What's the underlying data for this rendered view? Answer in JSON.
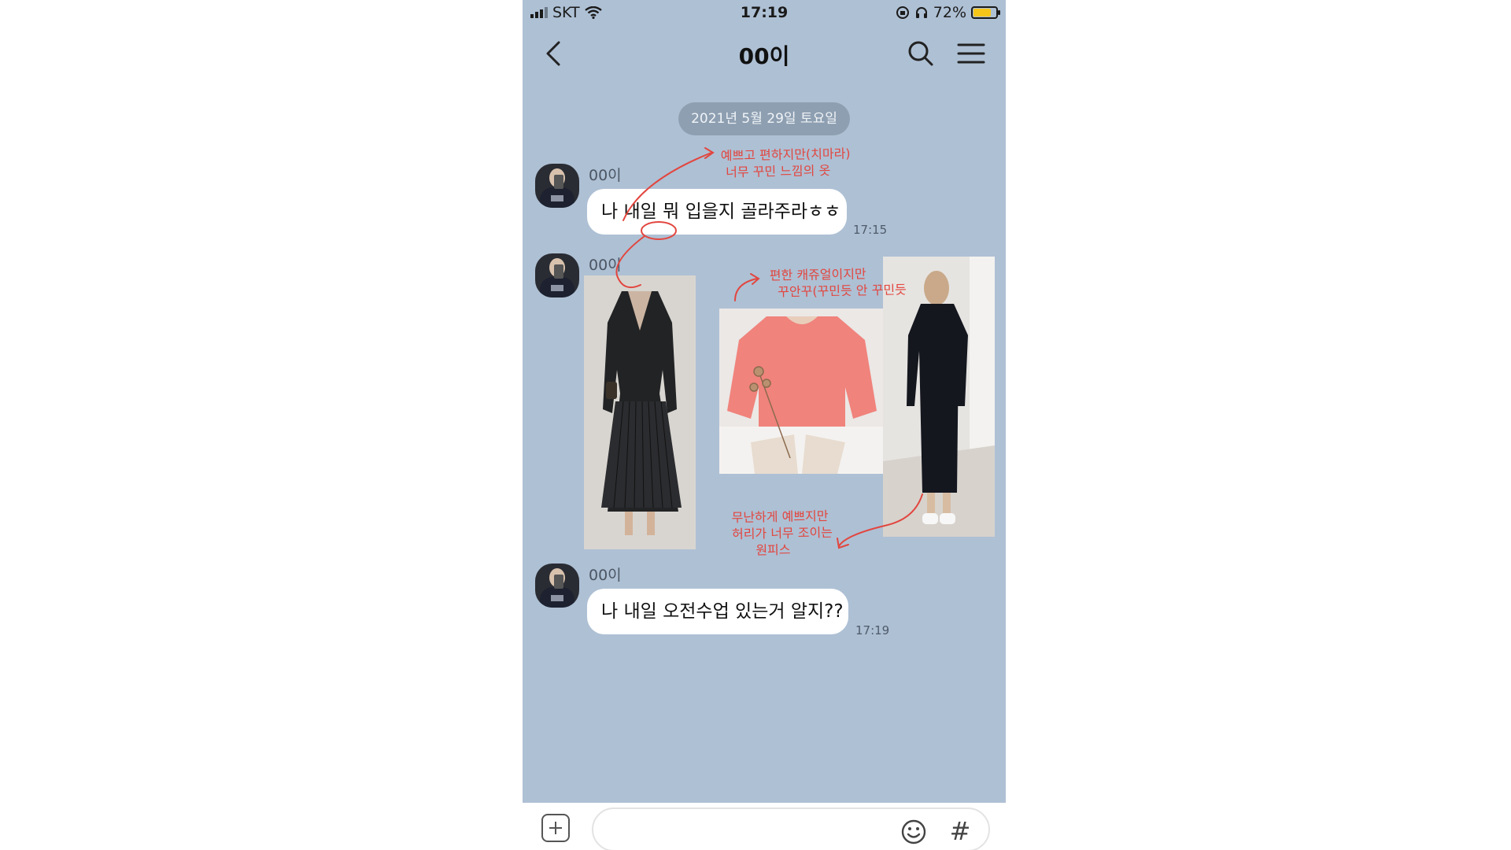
{
  "status_bar": {
    "carrier": "SKT",
    "time": "17:19",
    "battery_percent": "72%",
    "battery_level": 0.72
  },
  "header": {
    "title": "00이",
    "icons": [
      "back-arrow-icon",
      "search-icon",
      "menu-icon"
    ]
  },
  "date_divider": "2021년 5월 29일 토요일",
  "messages": [
    {
      "sender": "00이",
      "type": "text",
      "text": "나 내일 뭐 입을지 골라주라ㅎㅎ",
      "time": "17:15"
    },
    {
      "sender": "00이",
      "type": "photos"
    },
    {
      "sender": "00이",
      "type": "text",
      "text": "나 내일 오전수업 있는거 알지??",
      "time": "17:19"
    }
  ],
  "annotations": {
    "note1_line1": "예쁘고 편하지만(치마라)",
    "note1_line2": "너무 꾸민 느낌의 옷",
    "note2_line1": "편한 캐쥬얼이지만",
    "note2_line2": "꾸안꾸(꾸민듯 안 꾸민듯",
    "note3_line1": "무난하게 예쁘지만",
    "note3_line2": "허리가 너무 조이는",
    "note3_line3": "원피스",
    "color": "#e2463f"
  },
  "input_bar": {
    "placeholder": "",
    "icons": [
      "plus-icon",
      "emoji-icon",
      "hash-icon"
    ],
    "hash_label": "#"
  },
  "colors": {
    "chat_background": "#aec0d4",
    "bubble": "#ffffff",
    "date_pill": "#8e9fb1"
  }
}
